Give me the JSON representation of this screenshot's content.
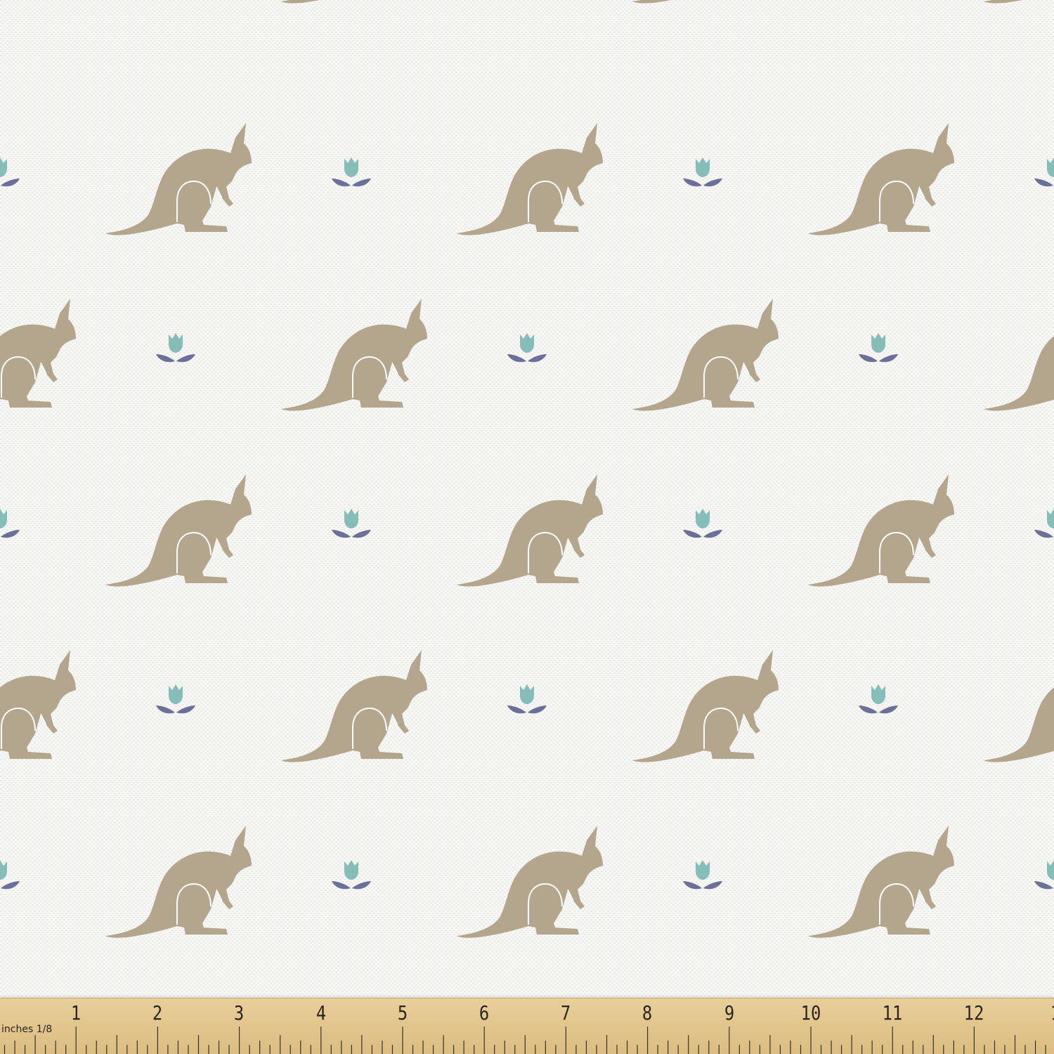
{
  "pattern": {
    "background": "#f7f7f5",
    "kangaroo_color": "#b3a68c",
    "bud_color": "#87bdb8",
    "leaf_color": "#6c6f98",
    "motifs": [
      "kangaroo-icon",
      "tulip-icon"
    ]
  },
  "ruler": {
    "unit_label": "inches",
    "fraction_label": "1/8",
    "numbers": [
      "1",
      "2",
      "3",
      "4",
      "5",
      "6",
      "7",
      "8",
      "9",
      "10",
      "11",
      "12",
      "1"
    ],
    "color": "#e2c68d"
  }
}
